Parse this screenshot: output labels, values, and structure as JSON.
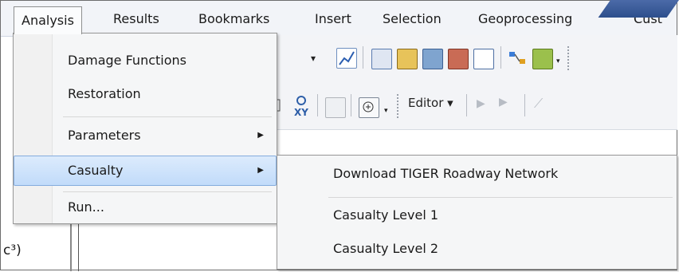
{
  "menubar": {
    "items": [
      "Analysis",
      "Results",
      "Bookmarks",
      "Insert",
      "Selection",
      "Geoprocessing",
      "Cust"
    ]
  },
  "analysis_menu": {
    "items": [
      {
        "label": "Damage Functions"
      },
      {
        "label": "Restoration"
      },
      {
        "label": "Parameters",
        "submenu_arrow": "▶"
      },
      {
        "label": "Casualty",
        "submenu_arrow": "▶",
        "highlighted": true
      },
      {
        "label": "Run..."
      }
    ]
  },
  "casualty_submenu": {
    "items": [
      {
        "label": "Download TIGER Roadway Network"
      },
      {
        "label": "Casualty Level 1"
      },
      {
        "label": "Casualty Level 2"
      }
    ]
  },
  "toolbar": {
    "combo_arrow": "▾",
    "editor_label": "Editor ▾"
  },
  "background_text": {
    "fragment": "c³)"
  },
  "colors": {
    "highlight_top": "#dcebfc",
    "highlight_bottom": "#c1dbfa",
    "highlight_border": "#84acdd",
    "menu_bg": "#f5f6f7"
  }
}
